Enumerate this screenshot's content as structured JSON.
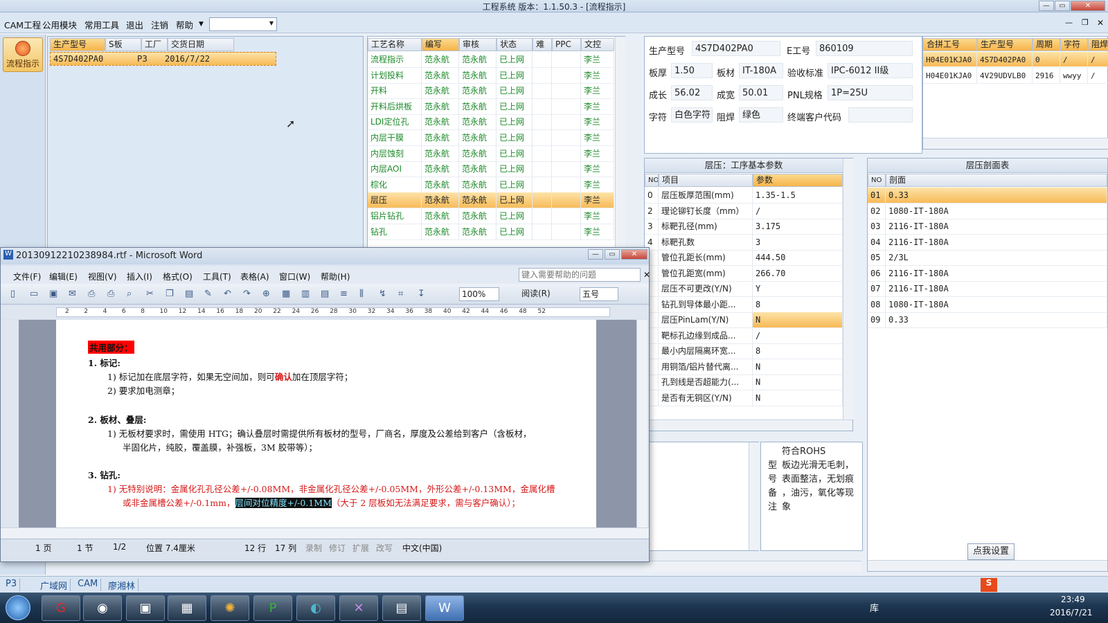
{
  "app": {
    "title": "工程系统    版本：1.1.50.3 - [流程指示]"
  },
  "menu": [
    "CAM工程",
    "公用模块",
    "常用工具",
    "退出",
    "注销",
    "帮助"
  ],
  "left_nav": {
    "flow_button": "流程指示"
  },
  "order_grid": {
    "headers": [
      "生产型号",
      "S板",
      "工厂",
      "交货日期"
    ],
    "rows": [
      [
        "4S7D402PA0",
        "",
        "P3",
        "2016/7/22"
      ]
    ]
  },
  "process_grid": {
    "headers": [
      "工艺名称",
      "编写",
      "审核",
      "状态",
      "难",
      "PPC",
      "文控"
    ],
    "rows": [
      [
        "流程指示",
        "范永航",
        "范永航",
        "已上网",
        "",
        "",
        "李兰"
      ],
      [
        "计划投料",
        "范永航",
        "范永航",
        "已上网",
        "",
        "",
        "李兰"
      ],
      [
        "开料",
        "范永航",
        "范永航",
        "已上网",
        "",
        "",
        "李兰"
      ],
      [
        "开料后烘板",
        "范永航",
        "范永航",
        "已上网",
        "",
        "",
        "李兰"
      ],
      [
        "LDI定位孔",
        "范永航",
        "范永航",
        "已上网",
        "",
        "",
        "李兰"
      ],
      [
        "内层干膜",
        "范永航",
        "范永航",
        "已上网",
        "",
        "",
        "李兰"
      ],
      [
        "内层蚀刻",
        "范永航",
        "范永航",
        "已上网",
        "",
        "",
        "李兰"
      ],
      [
        "内层AOI",
        "范永航",
        "范永航",
        "已上网",
        "",
        "",
        "李兰"
      ],
      [
        "棕化",
        "范永航",
        "范永航",
        "已上网",
        "",
        "",
        "李兰"
      ],
      [
        "层压",
        "范永航",
        "范永航",
        "已上网",
        "",
        "",
        "李兰"
      ],
      [
        "铝片钻孔",
        "范永航",
        "范永航",
        "已上网",
        "",
        "",
        "李兰"
      ],
      [
        "钻孔",
        "范永航",
        "范永航",
        "已上网",
        "",
        "",
        "李兰"
      ]
    ],
    "selected_index": 9
  },
  "info": {
    "fields": [
      {
        "label": "生产型号",
        "value": "4S7D402PA0"
      },
      {
        "label": "E工号",
        "value": "860109"
      },
      {
        "label": "板厚",
        "value": "1.50"
      },
      {
        "label": "板材",
        "value": "IT-180A"
      },
      {
        "label": "验收标准",
        "value": "IPC-6012 II级"
      },
      {
        "label": "成长",
        "value": "56.02"
      },
      {
        "label": "成宽",
        "value": "50.01"
      },
      {
        "label": "PNL规格",
        "value": "1P=25U"
      },
      {
        "label": "字符",
        "value": "白色字符"
      },
      {
        "label": "阻焊",
        "value": "绿色"
      },
      {
        "label": "终端客户代码",
        "value": ""
      }
    ]
  },
  "merge_grid": {
    "headers": [
      "合拼工号",
      "生产型号",
      "周期",
      "字符",
      "阻焊"
    ],
    "rows": [
      [
        "H04E01KJA0",
        "4S7D402PA0",
        "0",
        "/",
        "/"
      ],
      [
        "H04E01KJA0",
        "4V29UDVLB0",
        "2916",
        "wwyy",
        "/"
      ]
    ]
  },
  "params": {
    "title": "层压：工序基本参数",
    "headers": [
      "NO",
      "项目",
      "参数"
    ],
    "rows": [
      [
        "0",
        "层压板厚范围(mm)",
        "1.35-1.5"
      ],
      [
        "2",
        "理论铆钉长度（mm）",
        "/"
      ],
      [
        "3",
        "标靶孔径(mm)",
        "3.175"
      ],
      [
        "4",
        "标靶孔数",
        "3"
      ],
      [
        "",
        "管位孔距长(mm)",
        "444.50"
      ],
      [
        "",
        "管位孔距宽(mm)",
        "266.70"
      ],
      [
        "",
        "层压不可更改(Y/N)",
        "Y"
      ],
      [
        "",
        "钻孔到导体最小距...",
        "8"
      ],
      [
        "",
        "层压PinLam(Y/N)",
        "N"
      ],
      [
        "",
        "靶标孔边缘到成品...",
        "/"
      ],
      [
        "",
        "最小内层隔离环宽...",
        "8"
      ],
      [
        "",
        "用铜箔/铝片替代离...",
        "N"
      ],
      [
        "",
        "孔到线是否超能力(...",
        "N"
      ],
      [
        "",
        "是否有无铜区(Y/N)",
        "N"
      ]
    ],
    "selected_index": 8
  },
  "layup": {
    "title": "层压剖面表",
    "headers": [
      "NO",
      "剖面"
    ],
    "rows": [
      [
        "01",
        "0.33"
      ],
      [
        "02",
        "1080-IT-180A"
      ],
      [
        "03",
        "2116-IT-180A"
      ],
      [
        "04",
        "2116-IT-180A"
      ],
      [
        "05",
        "2/3L"
      ],
      [
        "06",
        "2116-IT-180A"
      ],
      [
        "07",
        "2116-IT-180A"
      ],
      [
        "08",
        "1080-IT-180A"
      ],
      [
        "09",
        "0.33"
      ]
    ],
    "button": "点我设置"
  },
  "remarks": {
    "label": "型号备注",
    "text": [
      "符合ROHS",
      "板边光滑无毛刺，",
      "表面整洁，无划痕",
      "，油污，氧化等现",
      "象"
    ]
  },
  "word": {
    "title": "20130912210238984.rtf - Microsoft Word",
    "menu": [
      "文件(F)",
      "编辑(E)",
      "视图(V)",
      "插入(I)",
      "格式(O)",
      "工具(T)",
      "表格(A)",
      "窗口(W)",
      "帮助(H)"
    ],
    "help_placeholder": "键入需要帮助的问题",
    "zoom": "100%",
    "read_mode": "阅读(R)",
    "font_size": "五号",
    "ruler": [
      "2",
      "2",
      "4",
      "6",
      "8",
      "10",
      "12",
      "14",
      "16",
      "18",
      "20",
      "22",
      "24",
      "26",
      "28",
      "30",
      "32",
      "34",
      "36",
      "38",
      "40",
      "42",
      "44",
      "46",
      "48",
      "52"
    ],
    "doc": {
      "heading": "共用部分：",
      "s1": "1.   标记:",
      "s1_i1_pre": "1)  标记加在底层字符，如果无空间加，则可",
      "s1_i1_red": "确认",
      "s1_i1_post": "加在顶层字符；",
      "s1_i2": "2)  要求加电测章；",
      "s2": "2.   板材、叠层:",
      "s2_i1_a": "1)  无板材要求时，需使用 HTG；确认叠层时需提供所有板材的型号，厂商名，厚度及公差给到客户（含板材，",
      "s2_i1_b": "半固化片，纯胶，覆盖膜，补强板，3M 胶带等）；",
      "s3": "3.   钻孔:",
      "s3_i1_a": "1)  无特别说明：金属化孔孔径公差+/-0.08MM，非金属化孔径公差+/-0.05MM，外形公差+/-0.13MM，金属化槽",
      "s3_i1_b": "或非金属槽公差+/-0.1mm，",
      "s3_i1_hl": "层间对位精度+/-0.1MM",
      "s3_i1_c": "（大于 2 层板如无法满足要求，需与客户确认）；"
    },
    "status": [
      "1 页",
      "1 节",
      "1/2",
      "位置 7.4厘米",
      "12 行",
      "17 列",
      "录制",
      "修订",
      "扩展",
      "改写",
      "中文(中国)"
    ]
  },
  "statusbar": [
    "P3",
    "广域网",
    "CAM",
    "廖湘林"
  ],
  "taskbar": {
    "time": "23:49",
    "date": "2016/7/21",
    "library": "库"
  }
}
